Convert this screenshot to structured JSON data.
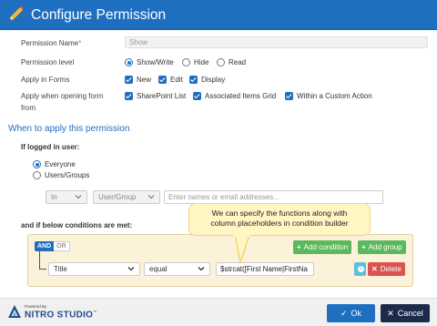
{
  "dialog": {
    "title": "Configure Permission"
  },
  "form": {
    "permission_name": {
      "label": "Permission Name",
      "required_mark": "*",
      "value": "Show"
    },
    "permission_level": {
      "label": "Permission level",
      "options": [
        "Show/Write",
        "Hide",
        "Read"
      ],
      "selected": "Show/Write"
    },
    "apply_in_forms": {
      "label": "Apply in Forms",
      "options": [
        "New",
        "Edit",
        "Display"
      ]
    },
    "apply_when_opening": {
      "label_line1": "Apply when opening form",
      "label_line2": "from",
      "options": [
        "SharePoint List",
        "Associated Items Grid",
        "Within a Custom Action"
      ]
    }
  },
  "when": {
    "section_title": "When to apply this permission",
    "logged_in_label": "If logged in user:",
    "user_options": [
      "Everyone",
      "Users/Groups"
    ],
    "selected": "Everyone",
    "in_select": "In",
    "usergroup_select": "User/Group",
    "users_placeholder": "Enter names or email addresses..."
  },
  "conditions": {
    "label": "and if below conditions are met:",
    "and_label": "AND",
    "or_label": "OR",
    "add_condition": "Add condition",
    "add_group": "Add group",
    "field_select": "Title",
    "operator_select": "equal",
    "value": "$strcat([First Name|FirstNa",
    "delete_label": "Delete",
    "info_glyph": "i"
  },
  "callout": {
    "line1": "We can specify the functions along with",
    "line2": "column placeholders in condition builder"
  },
  "footer": {
    "powered_by": "Powered By",
    "brand": "NITRO STUDIO",
    "trademark": "™",
    "ok_label": "Ok",
    "cancel_label": "Cancel"
  },
  "colors": {
    "primary": "#1f6fc1",
    "success": "#5cb85c",
    "danger": "#d9534f",
    "dark": "#1d2b4a",
    "callout": "#fff6c4"
  },
  "icons": [
    "pencil-icon",
    "chevron-down-icon",
    "plus-circle-icon",
    "info-icon",
    "x-icon",
    "check-icon",
    "nitro-logo-icon"
  ]
}
